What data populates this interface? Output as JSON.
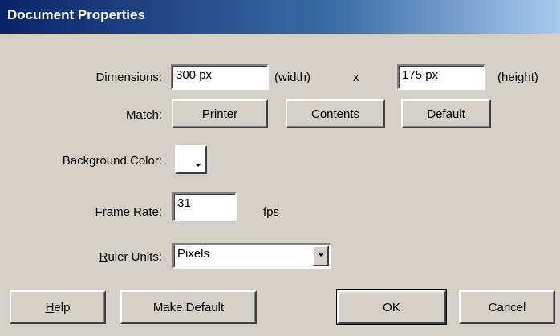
{
  "window": {
    "title": "Document Properties"
  },
  "dimensions": {
    "label": "Dimensions:",
    "width_value": "300 px",
    "width_suffix": "(width)",
    "separator": "x",
    "height_value": "175 px",
    "height_suffix": "(height)"
  },
  "match": {
    "label": "Match:",
    "printer_label": [
      "P",
      "rinter"
    ],
    "contents_label": [
      "C",
      "ontents"
    ],
    "default_label": [
      "D",
      "efault"
    ]
  },
  "background": {
    "label": "Background Color:",
    "color": "#ffffff"
  },
  "frame_rate": {
    "label": [
      "F",
      "rame Rate:"
    ],
    "value": "31",
    "unit": "fps"
  },
  "ruler_units": {
    "label": [
      "R",
      "uler Units:"
    ],
    "value": "Pixels"
  },
  "footer": {
    "help_label": [
      "H",
      "elp"
    ],
    "make_default_label": "Make Default",
    "ok_label": "OK",
    "cancel_label": "Cancel"
  },
  "colors": {
    "title_start": "#0a246a",
    "title_end": "#a6caf0",
    "dialog_bg": "#d4d0c8"
  }
}
